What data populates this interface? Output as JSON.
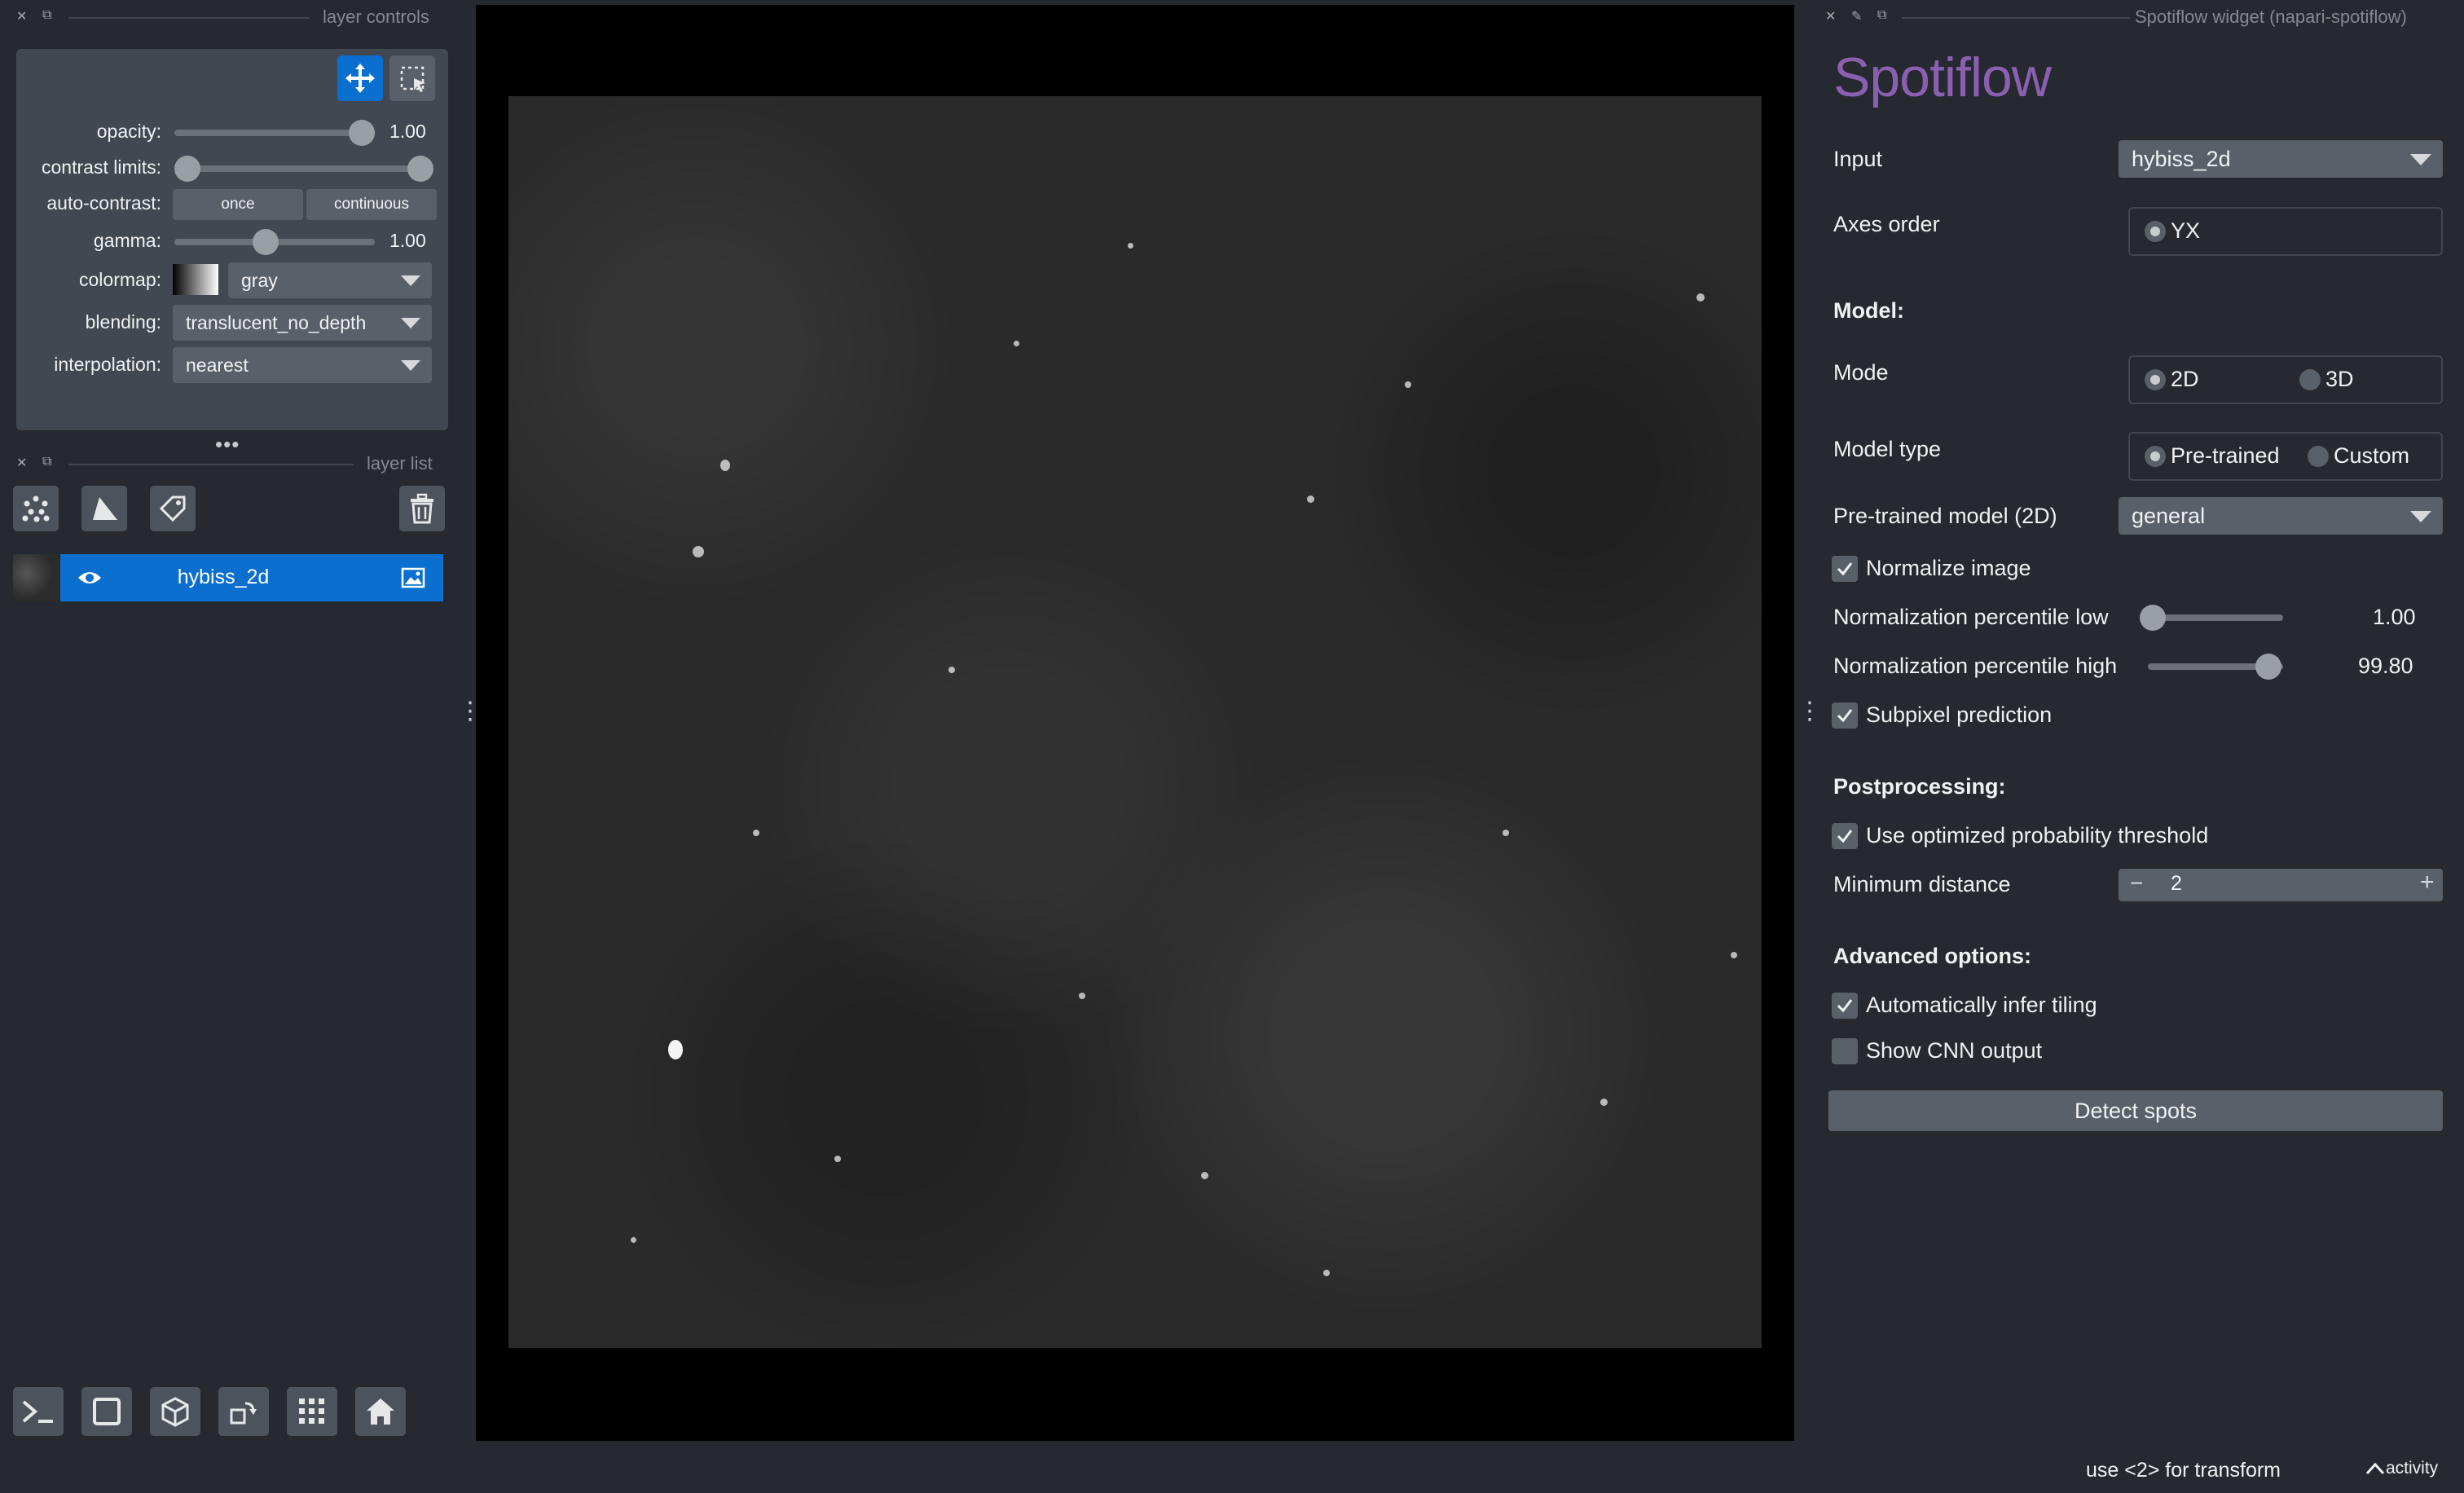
{
  "left_dock": {
    "controls_title": "layer controls",
    "list_title": "layer list",
    "controls": {
      "opacity": {
        "label": "opacity:",
        "value": "1.00",
        "level": 1.0
      },
      "contrast": {
        "label": "contrast limits:"
      },
      "auto_contrast": {
        "label": "auto-contrast:",
        "once": "once",
        "continuous": "continuous"
      },
      "gamma": {
        "label": "gamma:",
        "value": "1.00"
      },
      "colormap": {
        "label": "colormap:",
        "value": "gray"
      },
      "blending": {
        "label": "blending:",
        "value": "translucent_no_depth"
      },
      "interpolation": {
        "label": "interpolation:",
        "value": "nearest"
      }
    },
    "layers": [
      {
        "name": "hybiss_2d",
        "visible": true,
        "type_icon": "image-icon"
      }
    ]
  },
  "right_dock": {
    "title": "Spotiflow widget (napari-spotiflow)",
    "logo": "Spotiflow",
    "input": {
      "label": "Input",
      "value": "hybiss_2d"
    },
    "axes_order": {
      "label": "Axes order",
      "option": "YX"
    },
    "model_header": "Model:",
    "mode": {
      "label": "Mode",
      "options": [
        "2D",
        "3D"
      ],
      "selected": "2D"
    },
    "model_type": {
      "label": "Model type",
      "options": [
        "Pre-trained",
        "Custom"
      ],
      "selected": "Pre-trained"
    },
    "pretrained_model": {
      "label": "Pre-trained model (2D)",
      "value": "general"
    },
    "normalize": {
      "label": "Normalize image",
      "checked": true
    },
    "norm_low": {
      "label": "Normalization percentile low",
      "value": "1.00",
      "level": 0.01
    },
    "norm_high": {
      "label": "Normalization percentile high",
      "value": "99.80",
      "level": 0.998
    },
    "subpixel": {
      "label": "Subpixel prediction",
      "checked": true
    },
    "post_header": "Postprocessing:",
    "opt_threshold": {
      "label": "Use optimized probability threshold",
      "checked": true
    },
    "min_distance": {
      "label": "Minimum distance",
      "value": "2",
      "minus": "−",
      "plus": "+"
    },
    "adv_header": "Advanced options:",
    "infer_tiling": {
      "label": "Automatically infer tiling",
      "checked": true
    },
    "show_cnn": {
      "label": "Show CNN output",
      "checked": false
    },
    "detect_button": "Detect spots"
  },
  "status_bar": {
    "message": "use <2> for transform",
    "activity": "activity"
  },
  "colors": {
    "background": "#262930",
    "panel": "#414851",
    "accent": "#0a6fcf",
    "logo": "#8a5fb0"
  }
}
